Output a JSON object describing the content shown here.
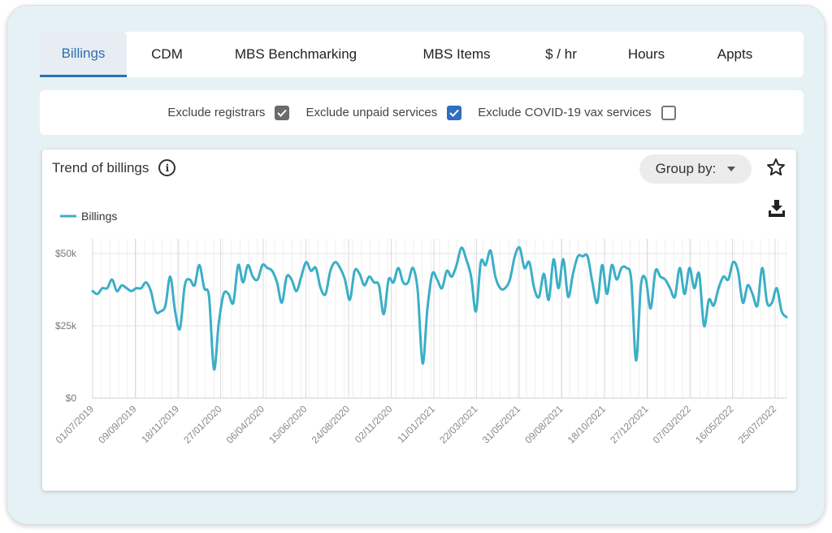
{
  "tabs": [
    {
      "label": "Billings",
      "active": true
    },
    {
      "label": "CDM"
    },
    {
      "label": "MBS Benchmarking"
    },
    {
      "label": "MBS Items"
    },
    {
      "label": "$ / hr"
    },
    {
      "label": "Hours"
    },
    {
      "label": "Appts"
    }
  ],
  "filters": [
    {
      "label": "Exclude registrars",
      "checked": true,
      "style": "grey"
    },
    {
      "label": "Exclude unpaid services",
      "checked": true,
      "style": "blue"
    },
    {
      "label": "Exclude COVID-19 vax services",
      "checked": false,
      "style": "empty"
    }
  ],
  "card": {
    "title": "Trend of billings",
    "group_by_label": "Group by:",
    "icons": [
      "info-icon",
      "star-icon",
      "download-icon",
      "chevron-down-icon"
    ]
  },
  "colors": {
    "accent": "#2f6fae",
    "line": "#3aafc6",
    "checkbox_blue": "#2f6ec2"
  },
  "chart_data": {
    "type": "line",
    "title": "",
    "legend": "top-left",
    "y_ticks": [
      "$50k",
      "$25k",
      "$0"
    ],
    "ylim": [
      0,
      50000
    ],
    "x_ticks": [
      "01/07/2019",
      "09/09/2019",
      "18/11/2019",
      "27/01/2020",
      "06/04/2020",
      "15/06/2020",
      "24/08/2020",
      "02/11/2020",
      "11/01/2021",
      "22/03/2021",
      "31/05/2021",
      "09/08/2021",
      "18/10/2021",
      "27/12/2021",
      "07/03/2022",
      "16/05/2022",
      "25/07/2022"
    ],
    "series": [
      {
        "name": "Billings",
        "values": [
          37000,
          36000,
          38000,
          38000,
          41000,
          37000,
          39000,
          38000,
          37000,
          38000,
          38000,
          40000,
          37000,
          30000,
          30000,
          32000,
          42000,
          30000,
          24000,
          39000,
          41000,
          39000,
          46000,
          38000,
          35000,
          10000,
          26000,
          36000,
          36000,
          33000,
          46000,
          40000,
          46000,
          42000,
          41000,
          46000,
          45000,
          44000,
          40000,
          33000,
          42000,
          41000,
          37000,
          42000,
          47000,
          44000,
          45000,
          38000,
          36000,
          44000,
          47000,
          45000,
          41000,
          34000,
          44000,
          43000,
          39000,
          42000,
          40000,
          39000,
          29000,
          41000,
          40000,
          45000,
          40000,
          40000,
          45000,
          37000,
          12000,
          31000,
          43000,
          41000,
          38000,
          44000,
          42000,
          46000,
          52000,
          48000,
          42000,
          30000,
          47000,
          46000,
          51000,
          42000,
          38000,
          38000,
          41000,
          49000,
          52000,
          45000,
          47000,
          38000,
          35000,
          43000,
          34000,
          48000,
          38000,
          48000,
          35000,
          43000,
          49000,
          49000,
          49000,
          40000,
          33000,
          46000,
          36000,
          46000,
          41000,
          45000,
          45000,
          41000,
          13000,
          39000,
          41000,
          31000,
          44000,
          42000,
          41000,
          38000,
          35000,
          45000,
          36000,
          45000,
          38000,
          43000,
          25000,
          34000,
          32000,
          38000,
          42000,
          41000,
          47000,
          44000,
          33000,
          39000,
          36000,
          32000,
          45000,
          33000,
          33000,
          38000,
          30000,
          28000
        ]
      }
    ]
  }
}
